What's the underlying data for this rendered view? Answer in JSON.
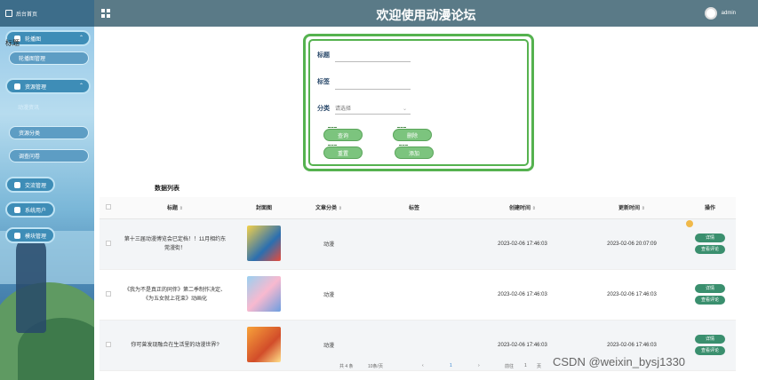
{
  "sidebar": {
    "home": "后台首页",
    "overlay_label": "标题",
    "menus": [
      {
        "label": "轮播图",
        "icon": "image-icon"
      },
      {
        "label": "资源管理",
        "icon": "location-icon"
      },
      {
        "label": "交流管理",
        "icon": "chat-icon"
      },
      {
        "label": "系统用户",
        "icon": "user-icon"
      },
      {
        "label": "模块管理",
        "icon": "grid-icon"
      }
    ],
    "subs": [
      "轮播图管理",
      "动漫资讯",
      "资源分类",
      "调查问卷"
    ]
  },
  "header": {
    "title": "欢迎使用动漫论坛",
    "user": "admin"
  },
  "search": {
    "title_label": "标题",
    "tag_label": "标签",
    "category_label": "分类",
    "category_placeholder": "请选择",
    "btn_query": "查询",
    "btn_delete": "删除",
    "btn_reset": "重置",
    "btn_add": "添加"
  },
  "list_title": "数据列表",
  "table": {
    "columns": [
      "",
      "标题",
      "封面图",
      "文章分类",
      "标签",
      "创建时间",
      "更新时间",
      "操作"
    ],
    "rows": [
      {
        "title": "第十三届动漫博览会已定档！！11月相约东莞漫街！",
        "category": "动漫",
        "tag": "",
        "created": "2023-02-06 17:46:03",
        "updated": "2023-02-06 20:07:09",
        "a1": "详情",
        "a2": "查看评论"
      },
      {
        "title": "《我为不是真正的同伴》第二季制作决定、《为五女就上花束》动画化",
        "category": "动漫",
        "tag": "",
        "created": "2023-02-06 17:46:03",
        "updated": "2023-02-06 17:46:03",
        "a1": "详情",
        "a2": "查看评论"
      },
      {
        "title": "你可曾发现融合在生活里的动漫世界?",
        "category": "动漫",
        "tag": "",
        "created": "2023-02-06 17:46:03",
        "updated": "2023-02-06 17:46:03",
        "a1": "详情",
        "a2": "查看评论"
      }
    ]
  },
  "pager": {
    "total": "共 4 条",
    "size": "10条/页",
    "current": "1",
    "goto_label": "前往",
    "goto_value": "1",
    "page_suffix": "页"
  },
  "watermark": "CSDN @weixin_bysj1330"
}
